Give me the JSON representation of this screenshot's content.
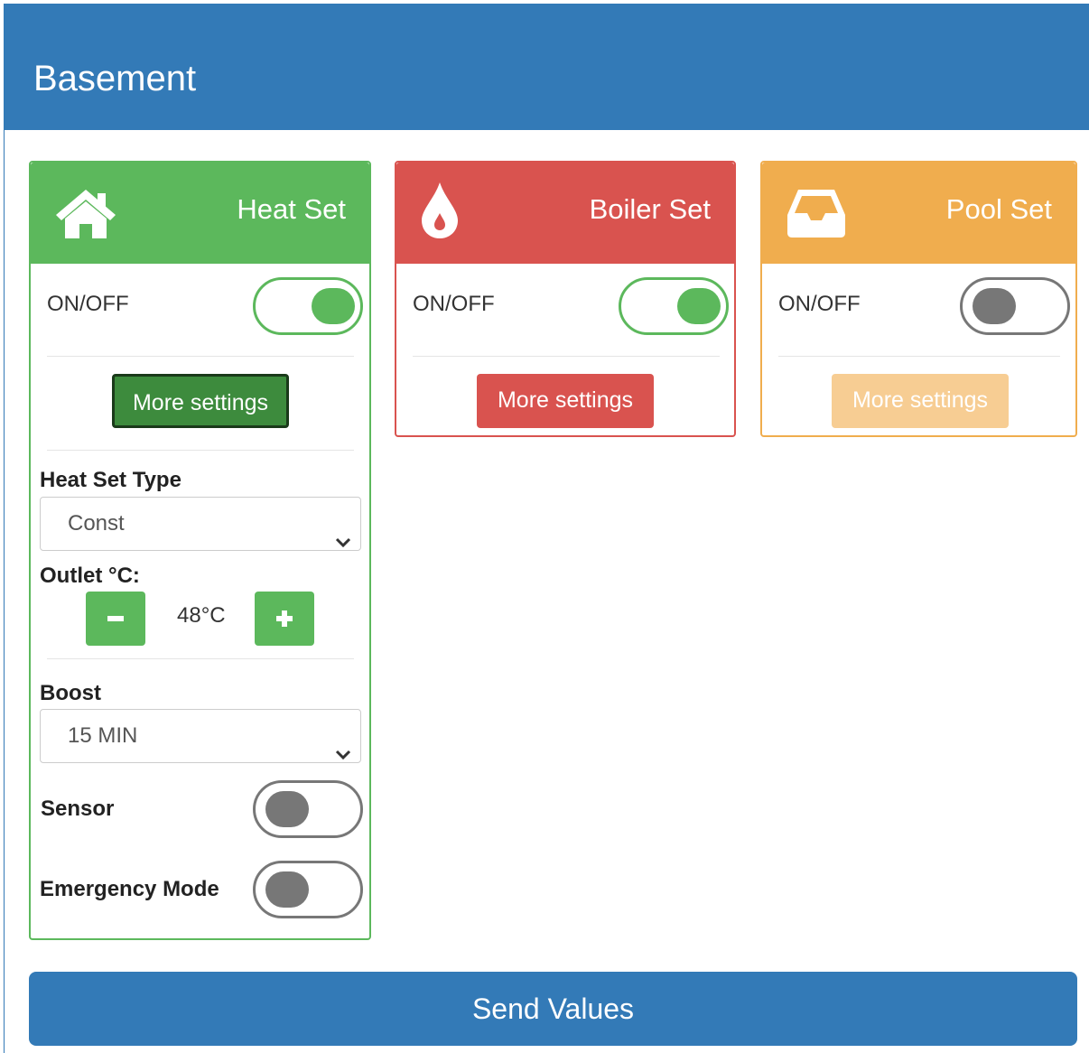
{
  "panel": {
    "title": "Basement"
  },
  "cards": {
    "heat": {
      "title": "Heat Set",
      "icon": "home-icon",
      "onoff_label": "ON/OFF",
      "onoff_state": true,
      "more_label": "More settings",
      "type_label": "Heat Set Type",
      "type_value": "Const",
      "outlet_label": "Outlet °C:",
      "outlet_value": "48°C",
      "boost_label": "Boost",
      "boost_value": "15 MIN",
      "sensor_label": "Sensor",
      "sensor_state": false,
      "emergency_label": "Emergency Mode",
      "emergency_state": false
    },
    "boiler": {
      "title": "Boiler Set",
      "icon": "water-drop-icon",
      "onoff_label": "ON/OFF",
      "onoff_state": true,
      "more_label": "More settings"
    },
    "pool": {
      "title": "Pool Set",
      "icon": "inbox-tray-icon",
      "onoff_label": "ON/OFF",
      "onoff_state": false,
      "more_label": "More settings"
    }
  },
  "actions": {
    "send_label": "Send Values"
  },
  "colors": {
    "primary": "#337ab7",
    "success": "#5cb85c",
    "danger": "#d9534f",
    "warning": "#f0ad4e"
  }
}
